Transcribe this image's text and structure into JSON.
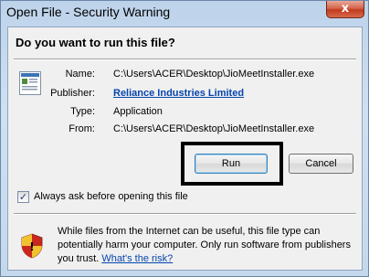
{
  "window": {
    "title": "Open File - Security Warning",
    "close_glyph": "x"
  },
  "dialog": {
    "heading": "Do you want to run this file?",
    "fields": [
      {
        "label": "Name:",
        "value": "C:\\Users\\ACER\\Desktop\\JioMeetInstaller.exe"
      },
      {
        "label": "Publisher:",
        "value": "Reliance Industries Limited"
      },
      {
        "label": "Type:",
        "value": "Application"
      },
      {
        "label": "From:",
        "value": "C:\\Users\\ACER\\Desktop\\JioMeetInstaller.exe"
      }
    ],
    "buttons": {
      "run": "Run",
      "cancel": "Cancel"
    },
    "checkbox": {
      "label": "Always ask before opening this file",
      "checked": true,
      "mark": "✓"
    },
    "warning": {
      "text": "While files from the Internet can be useful, this file type can potentially harm your computer. Only run software from publishers you trust.",
      "link": "What's the risk?"
    }
  },
  "icons": {
    "app": "application-file-icon",
    "shield": "security-shield-icon",
    "close": "close-icon"
  },
  "colors": {
    "link": "#0645ad",
    "close_button": "#c23a1c",
    "shield_red": "#c8281e",
    "shield_yellow": "#f2c12e"
  }
}
